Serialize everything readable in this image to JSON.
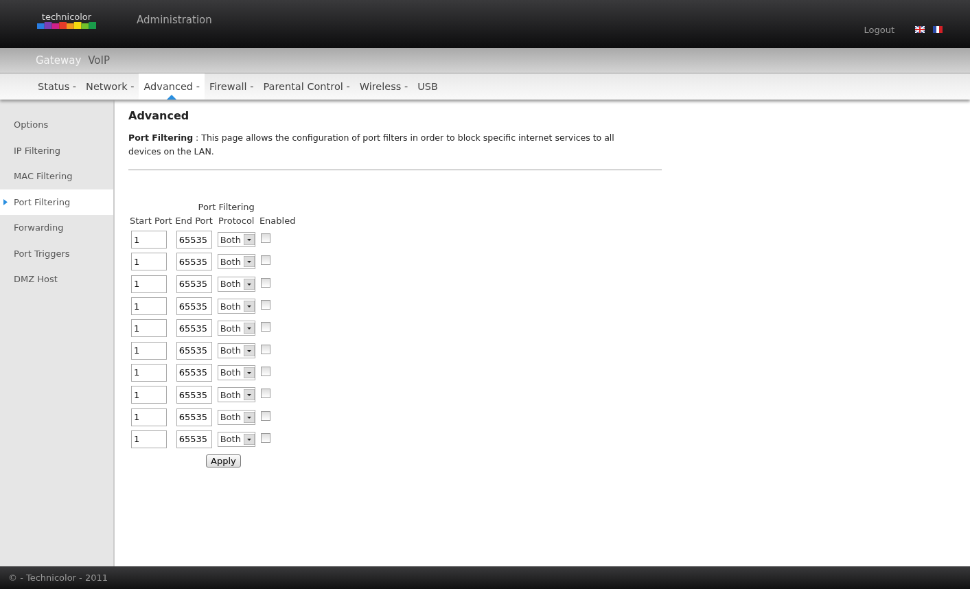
{
  "header": {
    "logo": "technicolor",
    "title": "Administration",
    "logout": "Logout"
  },
  "main_tabs": [
    {
      "label": "Gateway",
      "selected": true
    },
    {
      "label": "VoIP",
      "selected": false
    }
  ],
  "sub_tabs": [
    {
      "label": "Status -",
      "selected": false
    },
    {
      "label": "Network -",
      "selected": false
    },
    {
      "label": "Advanced -",
      "selected": true
    },
    {
      "label": "Firewall -",
      "selected": false
    },
    {
      "label": "Parental Control -",
      "selected": false
    },
    {
      "label": "Wireless -",
      "selected": false
    },
    {
      "label": "USB",
      "selected": false
    }
  ],
  "sidebar": {
    "items": [
      {
        "label": "Options",
        "selected": false
      },
      {
        "label": "IP Filtering",
        "selected": false
      },
      {
        "label": "MAC Filtering",
        "selected": false
      },
      {
        "label": "Port Filtering",
        "selected": true
      },
      {
        "label": "Forwarding",
        "selected": false
      },
      {
        "label": "Port Triggers",
        "selected": false
      },
      {
        "label": "DMZ Host",
        "selected": false
      }
    ]
  },
  "page": {
    "title": "Advanced",
    "description": "**Port Filtering**  :  This page allows the configuration of port filters in order to block specific internet services to all devices on the LAN."
  },
  "table": {
    "title": "Port Filtering",
    "columns": [
      "Start Port",
      "End Port",
      "Protocol",
      "Enabled"
    ],
    "rows": [
      {
        "start": "1",
        "end": "65535",
        "protocol": "Both",
        "enabled": false
      },
      {
        "start": "1",
        "end": "65535",
        "protocol": "Both",
        "enabled": false
      },
      {
        "start": "1",
        "end": "65535",
        "protocol": "Both",
        "enabled": false
      },
      {
        "start": "1",
        "end": "65535",
        "protocol": "Both",
        "enabled": false
      },
      {
        "start": "1",
        "end": "65535",
        "protocol": "Both",
        "enabled": false
      },
      {
        "start": "1",
        "end": "65535",
        "protocol": "Both",
        "enabled": false
      },
      {
        "start": "1",
        "end": "65535",
        "protocol": "Both",
        "enabled": false
      },
      {
        "start": "1",
        "end": "65535",
        "protocol": "Both",
        "enabled": false
      },
      {
        "start": "1",
        "end": "65535",
        "protocol": "Both",
        "enabled": false
      },
      {
        "start": "1",
        "end": "65535",
        "protocol": "Both",
        "enabled": false
      }
    ]
  },
  "apply_button": "Apply",
  "footer": "© - Technicolor - 2011"
}
